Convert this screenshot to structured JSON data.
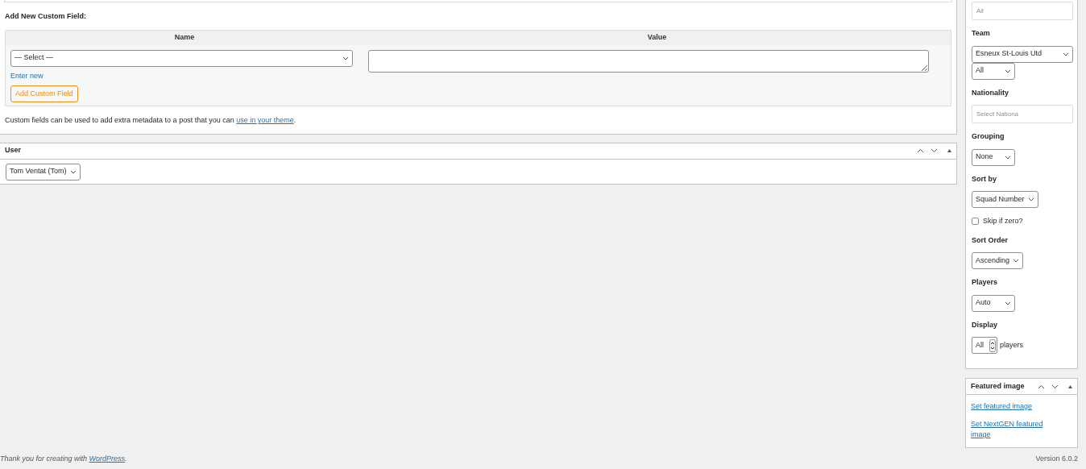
{
  "custom_fields": {
    "heading": "Add New Custom Field:",
    "columns": [
      "Name",
      "Value"
    ],
    "name_select": "— Select —",
    "enter_new": "Enter new",
    "add_button": "Add Custom Field",
    "note": {
      "before": "Custom fields can be used to add extra metadata to a post that you can ",
      "link": "use in your theme",
      "after": "."
    }
  },
  "user_box": {
    "title": "User",
    "select": "Tom Ventat (Tom)"
  },
  "sidebar": {
    "fields": [
      {
        "kind": "input",
        "placeholder": "All"
      },
      {
        "kind": "label",
        "text": "Team"
      },
      {
        "kind": "wide_select",
        "value": "Esneux St-Louis Utd"
      },
      {
        "kind": "select",
        "value": "All"
      },
      {
        "kind": "label",
        "text": "Nationality"
      },
      {
        "kind": "input",
        "placeholder": "Select Nationa"
      },
      {
        "kind": "label",
        "text": "Grouping"
      },
      {
        "kind": "select",
        "value": "None"
      },
      {
        "kind": "label",
        "text": "Sort by"
      },
      {
        "kind": "select",
        "value": "Squad Number"
      },
      {
        "kind": "checkbox",
        "text": "Skip if zero?",
        "checked": false
      },
      {
        "kind": "label",
        "text": "Sort Order"
      },
      {
        "kind": "select",
        "value": "Ascending"
      },
      {
        "kind": "label",
        "text": "Players"
      },
      {
        "kind": "select",
        "value": "Auto"
      },
      {
        "kind": "label",
        "text": "Display"
      },
      {
        "kind": "number",
        "value": "All",
        "suffix": "players"
      }
    ]
  },
  "featured_image": {
    "title": "Featured image",
    "links": [
      "Set featured image",
      "Set NextGEN featured image"
    ]
  },
  "footer": {
    "before": "Thank you for creating with ",
    "link": "WordPress",
    "after": ".",
    "version": "Version 6.0.2"
  }
}
